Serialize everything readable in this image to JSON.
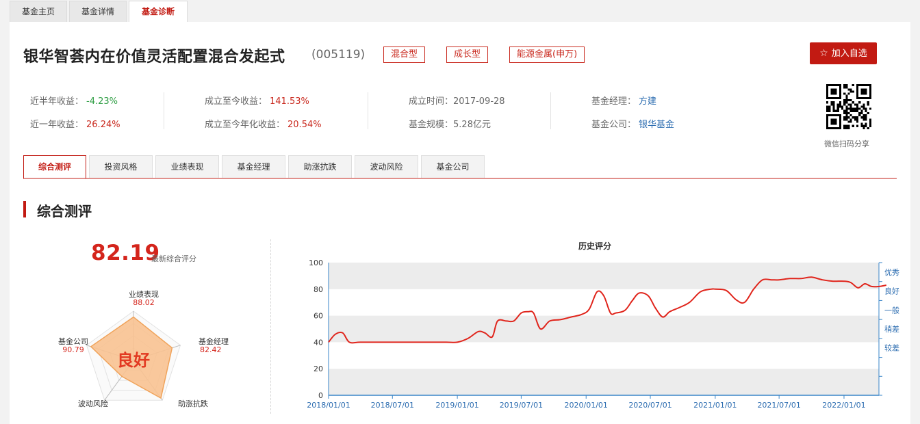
{
  "top_tabs": [
    {
      "label": "基金主页"
    },
    {
      "label": "基金详情"
    },
    {
      "label": "基金诊断"
    }
  ],
  "fund": {
    "name": "银华智荟内在价值灵活配置混合发起式",
    "code": "(005119)",
    "tags": [
      "混合型",
      "成长型",
      "能源金属(申万)"
    ],
    "add_button": "加入自选"
  },
  "stats": {
    "half_year_label": "近半年收益：",
    "half_year_value": "-4.23%",
    "one_year_label": "近一年收益：",
    "one_year_value": "26.24%",
    "since_label": "成立至今收益：",
    "since_value": "141.53%",
    "annual_label": "成立至今年化收益：",
    "annual_value": "20.54%",
    "setup_label": "成立时间：",
    "setup_value": "2017-09-28",
    "scale_label": "基金规模：",
    "scale_value": "5.28亿元",
    "manager_label": "基金经理：",
    "manager_value": "方建",
    "company_label": "基金公司：",
    "company_value": "银华基金"
  },
  "qr_label": "微信扫码分享",
  "sub_tabs": [
    "综合测评",
    "投资风格",
    "业绩表现",
    "基金经理",
    "助涨抗跌",
    "波动风险",
    "基金公司"
  ],
  "section_title": "综合测评",
  "score": {
    "value": "82.19",
    "label": "最新综合评分",
    "grade": "良好"
  },
  "radar": [
    {
      "name": "业绩表现",
      "value": "88.02",
      "score": 88.02
    },
    {
      "name": "基金经理",
      "value": "82.42",
      "score": 82.42
    },
    {
      "name": "助涨抗跌",
      "value": "94.62",
      "score": 94.62
    },
    {
      "name": "波动风险",
      "value": "40.24",
      "score": 40.24
    },
    {
      "name": "基金公司",
      "value": "90.79",
      "score": 90.79
    }
  ],
  "colors": {
    "accent": "#c21a12",
    "line": "#e0241b",
    "axis": "#3a86c8",
    "radar_fill": "#f8c291",
    "radar_stroke": "#f0a35a"
  },
  "chart_data": {
    "type": "line",
    "title": "历史评分",
    "xlabel": "",
    "ylabel": "",
    "ylim": [
      0,
      100
    ],
    "y_ticks": [
      "0",
      "20",
      "40",
      "60",
      "80",
      "100"
    ],
    "x_ticks": [
      "2018/01/01",
      "2018/07/01",
      "2019/01/01",
      "2019/07/01",
      "2020/01/01",
      "2020/07/01",
      "2021/01/01",
      "2021/07/01",
      "2022/01/01"
    ],
    "right_axis_labels": [
      "优秀",
      "良好",
      "一般",
      "稍差",
      "较差"
    ],
    "grid": "alternating bands",
    "series": [
      {
        "x": [
          "2018/01/01",
          "2018/01/20",
          "2018/02/10",
          "2018/03/01",
          "2018/04/01",
          "2018/06/01",
          "2018/08/01",
          "2018/10/01",
          "2018/12/01",
          "2019/01/01",
          "2019/02/01",
          "2019/03/01",
          "2019/03/20",
          "2019/04/10",
          "2019/04/25",
          "2019/05/20",
          "2019/06/10",
          "2019/07/01",
          "2019/07/20",
          "2019/08/05",
          "2019/08/25",
          "2019/09/20",
          "2019/10/20",
          "2019/11/20",
          "2019/12/20",
          "2020/01/10",
          "2020/02/01",
          "2020/02/20",
          "2020/03/10",
          "2020/03/25",
          "2020/04/20",
          "2020/05/10",
          "2020/05/30",
          "2020/06/25",
          "2020/07/15",
          "2020/08/05",
          "2020/08/25",
          "2020/09/20",
          "2020/10/20",
          "2020/11/20",
          "2020/12/20",
          "2021/01/01",
          "2021/02/01",
          "2021/03/01",
          "2021/03/25",
          "2021/04/20",
          "2021/05/15",
          "2021/06/10",
          "2021/07/01",
          "2021/08/01",
          "2021/09/01",
          "2021/10/01",
          "2021/11/01",
          "2021/12/01",
          "2022/01/01",
          "2022/01/20",
          "2022/02/10",
          "2022/03/01",
          "2022/03/20",
          "2022/04/10",
          "2022/05/01"
        ],
        "y": [
          40,
          46,
          47,
          40,
          40,
          40,
          40,
          40,
          40,
          40,
          43,
          48,
          47,
          44,
          56,
          56,
          56,
          62,
          63,
          62,
          50,
          56,
          57,
          59,
          61,
          65,
          78,
          75,
          62,
          62,
          64,
          71,
          77,
          75,
          66,
          59,
          63,
          66,
          70,
          78,
          80,
          80,
          79,
          72,
          70,
          80,
          87,
          87,
          87,
          88,
          88,
          89,
          87,
          86,
          86,
          85,
          81,
          84,
          82,
          82,
          83
        ]
      }
    ]
  }
}
